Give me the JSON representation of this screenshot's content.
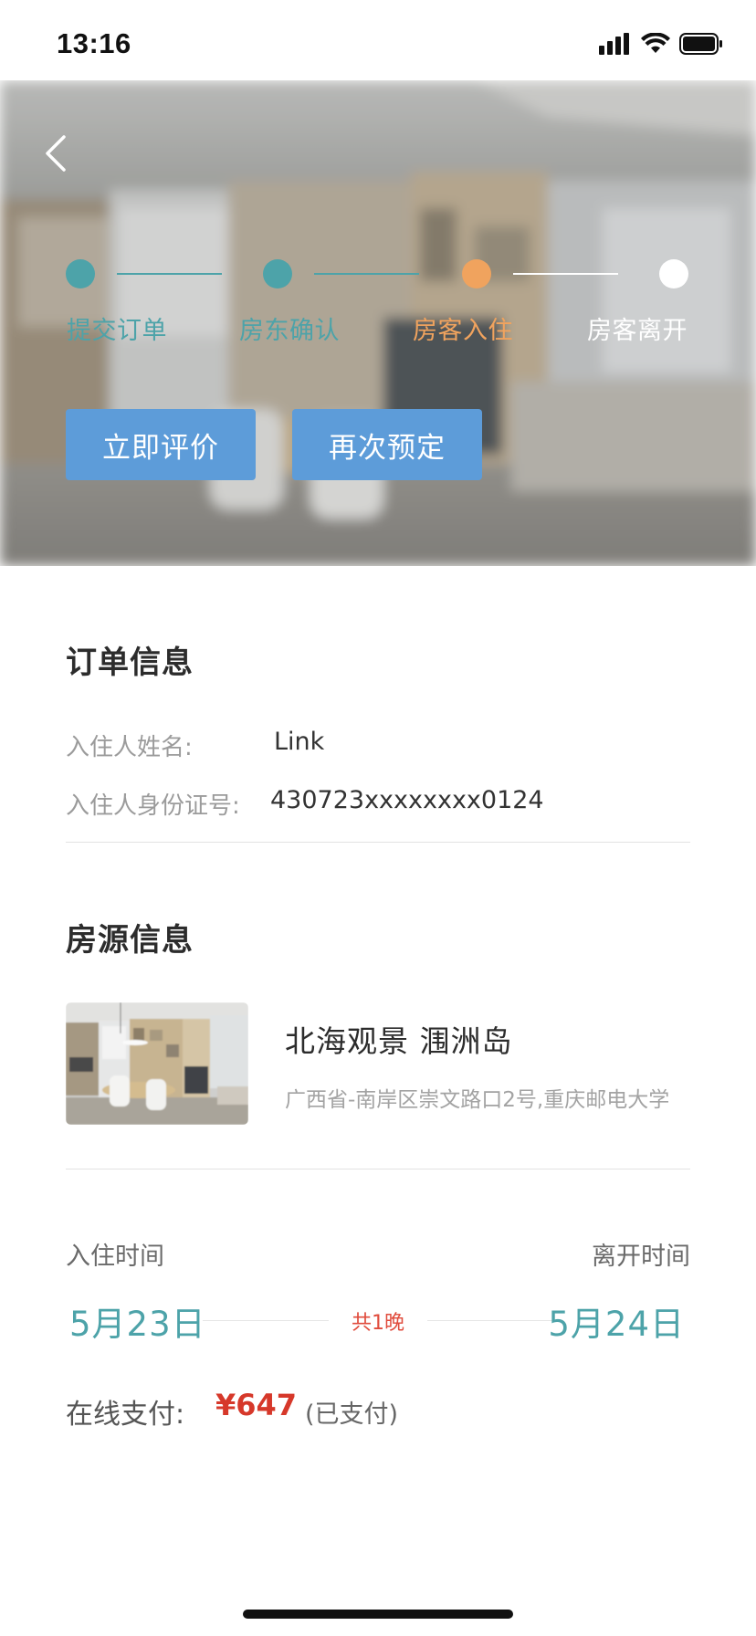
{
  "status_bar": {
    "time": "13:16"
  },
  "progress": {
    "steps": [
      {
        "label": "提交订单",
        "state": "done"
      },
      {
        "label": "房东确认",
        "state": "done"
      },
      {
        "label": "房客入住",
        "state": "current"
      },
      {
        "label": "房客离开",
        "state": "pending"
      }
    ]
  },
  "actions": {
    "review_label": "立即评价",
    "rebook_label": "再次预定"
  },
  "order_info": {
    "title": "订单信息",
    "guest_name_label": "入住人姓名:",
    "guest_name": "Link",
    "guest_id_label": "入住人身份证号:",
    "guest_id": "430723xxxxxxxx0124"
  },
  "property_info": {
    "title": "房源信息",
    "name": "北海观景 涠洲岛",
    "address": "广西省-南岸区崇文路口2号,重庆邮电大学"
  },
  "stay": {
    "checkin_label": "入住时间",
    "checkout_label": "离开时间",
    "checkin_date": "5月23日",
    "checkout_date": "5月24日",
    "nights": "共1晚"
  },
  "payment": {
    "label": "在线支付:",
    "amount": "¥647",
    "status": "(已支付)"
  },
  "colors": {
    "done": "#4da3a9",
    "current": "#f0a35e",
    "pending": "#ffffff",
    "button": "#5d9cd9",
    "price": "#d6382a"
  }
}
